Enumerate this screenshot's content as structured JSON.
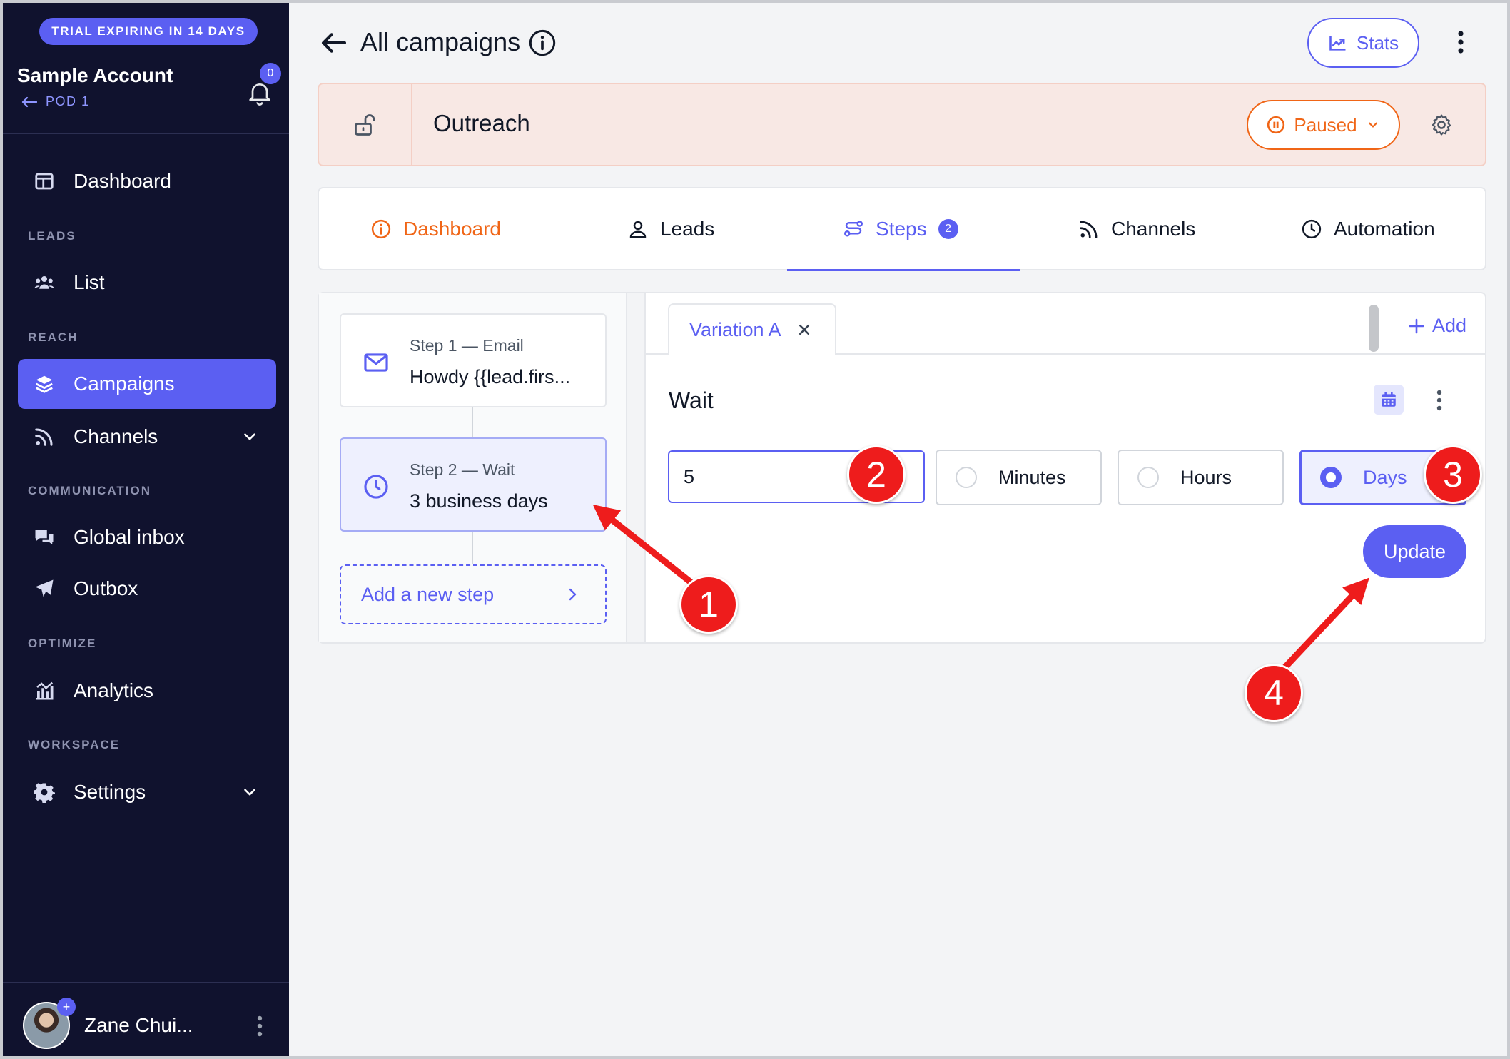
{
  "sidebar": {
    "trial_badge": "TRIAL EXPIRING IN 14 DAYS",
    "account_name": "Sample Account",
    "pod_label": "POD 1",
    "notification_count": "0",
    "items": [
      {
        "label": "Dashboard",
        "icon": "dashboard-icon"
      },
      {
        "label": "List",
        "icon": "users-icon"
      },
      {
        "label": "Campaigns",
        "icon": "layers-icon",
        "active": true
      },
      {
        "label": "Channels",
        "icon": "rss-icon",
        "expandable": true
      },
      {
        "label": "Global inbox",
        "icon": "chat-icon"
      },
      {
        "label": "Outbox",
        "icon": "paper-plane-icon"
      },
      {
        "label": "Analytics",
        "icon": "analytics-icon"
      },
      {
        "label": "Settings",
        "icon": "gear-icon",
        "expandable": true
      }
    ],
    "sections": {
      "leads": "LEADS",
      "reach": "REACH",
      "communication": "COMMUNICATION",
      "optimize": "OPTIMIZE",
      "workspace": "WORKSPACE"
    },
    "user": {
      "name": "Zane Chui...",
      "avatar_badge": "+"
    }
  },
  "header": {
    "title": "All campaigns",
    "stats_label": "Stats"
  },
  "campaign": {
    "name": "Outreach",
    "status_label": "Paused"
  },
  "tabs": [
    {
      "label": "Dashboard",
      "icon": "info-circle-icon"
    },
    {
      "label": "Leads",
      "icon": "user-icon"
    },
    {
      "label": "Steps",
      "icon": "route-icon",
      "badge": "2",
      "active": true
    },
    {
      "label": "Channels",
      "icon": "rss-icon"
    },
    {
      "label": "Automation",
      "icon": "clock-icon"
    }
  ],
  "steps": [
    {
      "sub": "Step 1 — Email",
      "main": "Howdy {{lead.firs...",
      "icon": "mail-icon"
    },
    {
      "sub": "Step 2 — Wait",
      "main": "3 business days",
      "icon": "clock-icon",
      "selected": true
    }
  ],
  "add_step_label": "Add a new step",
  "variation": {
    "tab_label": "Variation A",
    "add_label": "Add"
  },
  "wait_editor": {
    "title": "Wait",
    "value": "5",
    "units": [
      "Minutes",
      "Hours",
      "Days"
    ],
    "selected_unit": "Days",
    "update_label": "Update"
  },
  "annotations": [
    "1",
    "2",
    "3",
    "4"
  ],
  "colors": {
    "sidebar_bg": "#10122e",
    "accent": "#5b5ff2",
    "paused": "#f06516",
    "campaign_bar_bg": "#f8e8e4",
    "marker": "#ee1c1c"
  }
}
